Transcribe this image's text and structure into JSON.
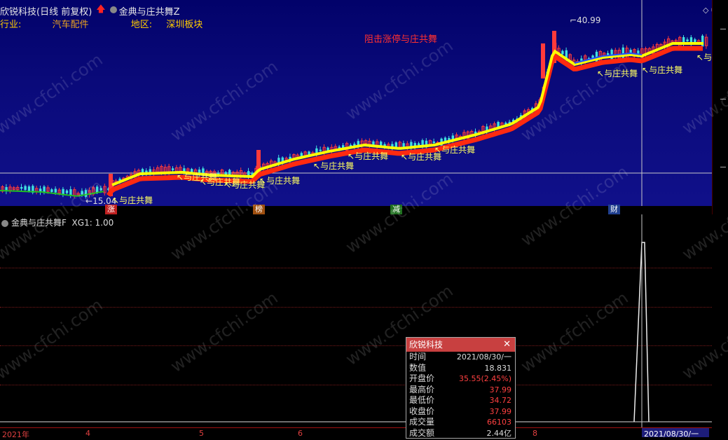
{
  "header": {
    "stock_name": "欣锐科技",
    "period": "(日线 前复权)",
    "indicator": "金典与庄共舞Z"
  },
  "info": {
    "industry_label": "行业:",
    "industry_value": "汽车配件",
    "region_label": "地区:",
    "region_value": "深圳板块"
  },
  "chart_labels": {
    "blocker": "阻击涨停与庄共舞",
    "high_price": "40.99",
    "low_price": "15.04",
    "annotation": "与庄共舞"
  },
  "tags": [
    {
      "text": "涨",
      "bg": "#c02020"
    },
    {
      "text": "榜",
      "bg": "#a05010"
    },
    {
      "text": "减",
      "bg": "#207020"
    },
    {
      "text": "财",
      "bg": "#204090"
    }
  ],
  "sub_chart": {
    "indicator": "金典与庄共舞F",
    "series": "XG1: 1.00"
  },
  "x_axis": {
    "labels": [
      "2021年",
      "4",
      "5",
      "6",
      "8"
    ],
    "cursor_date": "2021/08/30/一"
  },
  "popup": {
    "title": "欣锐科技",
    "rows": [
      {
        "k": "时间",
        "v": "2021/08/30/一",
        "color": "#dddddd"
      },
      {
        "k": "数值",
        "v": "18.831",
        "color": "#dddddd"
      },
      {
        "k": "开盘价",
        "v": "35.55(2.45%)",
        "color": "#ff4040"
      },
      {
        "k": "最高价",
        "v": "37.99",
        "color": "#ff4040"
      },
      {
        "k": "最低价",
        "v": "34.72",
        "color": "#ff4040"
      },
      {
        "k": "收盘价",
        "v": "37.99",
        "color": "#ff4040"
      },
      {
        "k": "成交量",
        "v": "66103",
        "color": "#ff4040"
      },
      {
        "k": "成交额",
        "v": "2.44亿",
        "color": "#dddddd"
      }
    ]
  },
  "colors": {
    "up": "#ff3a3a",
    "down": "#40e0e0",
    "ma_fast": "#ffff00",
    "ma_slow": "#ff2a10",
    "ma_mid": "#2050ff",
    "early": "#20c020"
  },
  "watermark_text": "www.cfchi.com"
}
